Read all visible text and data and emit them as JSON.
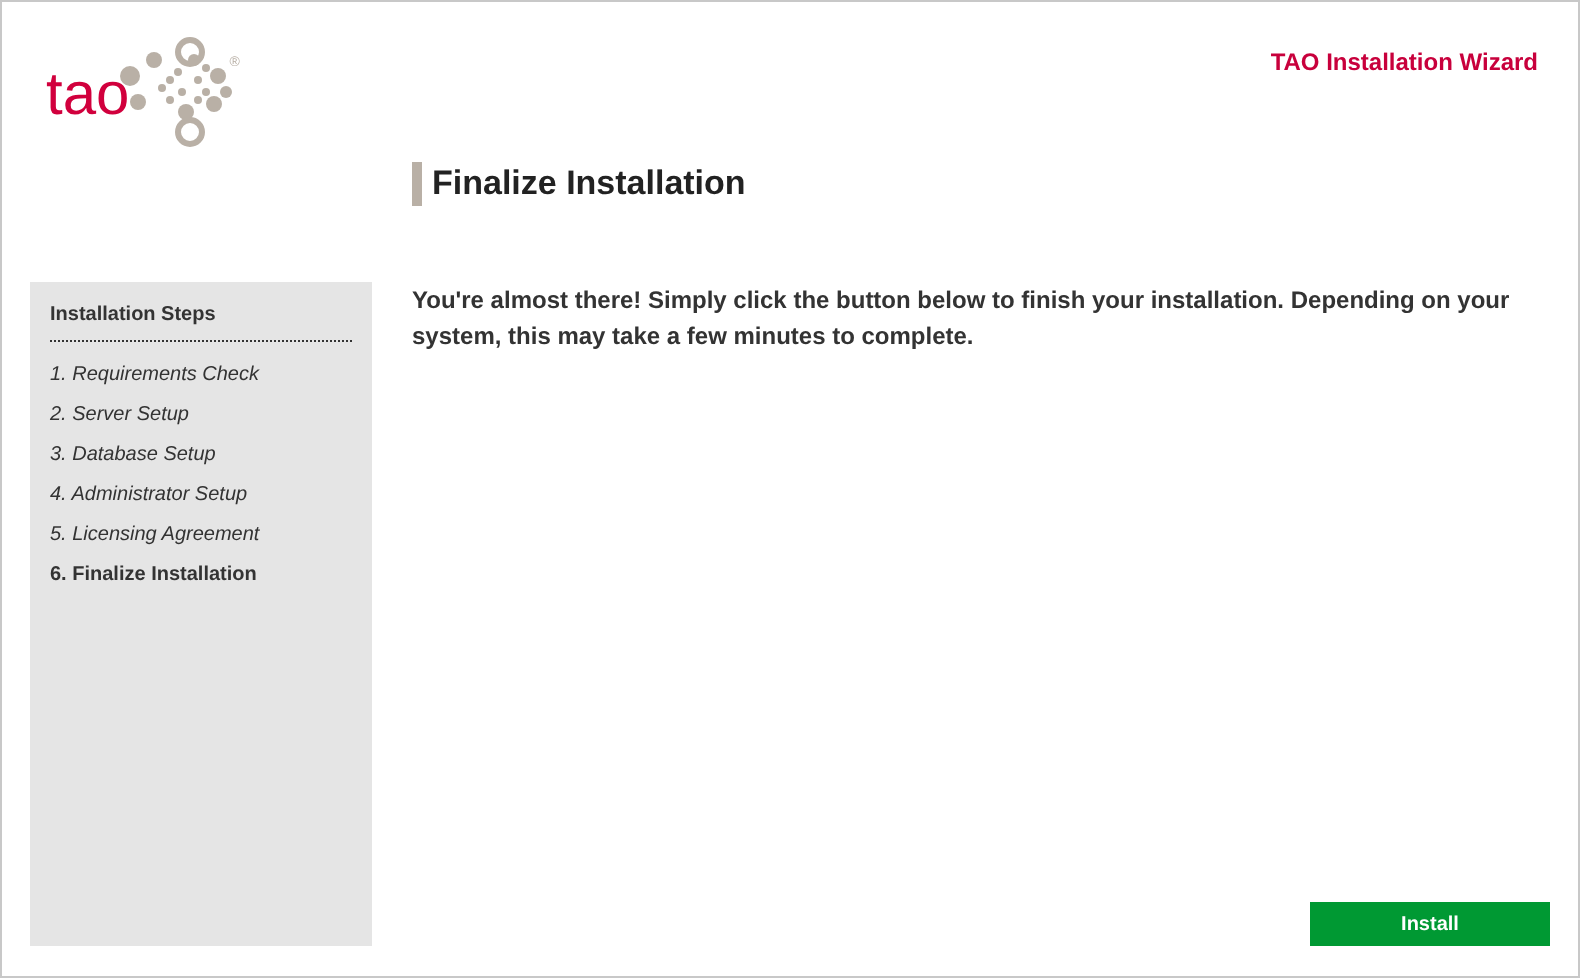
{
  "logo": {
    "text": "tao",
    "mark": "®"
  },
  "header": {
    "title": "TAO Installation Wizard"
  },
  "page_heading": "Finalize Installation",
  "sidebar": {
    "title": "Installation Steps",
    "items": [
      {
        "label": "1. Requirements Check",
        "selected": false
      },
      {
        "label": "2. Server Setup",
        "selected": false
      },
      {
        "label": "3. Database Setup",
        "selected": false
      },
      {
        "label": "4. Administrator Setup",
        "selected": false
      },
      {
        "label": "5. Licensing Agreement",
        "selected": false
      },
      {
        "label": "6. Finalize Installation",
        "selected": true
      }
    ]
  },
  "message": "You're almost there! Simply click the button below to finish your installation. Depending on your system, this may take a few minutes to complete.",
  "buttons": [
    "Install"
  ]
}
